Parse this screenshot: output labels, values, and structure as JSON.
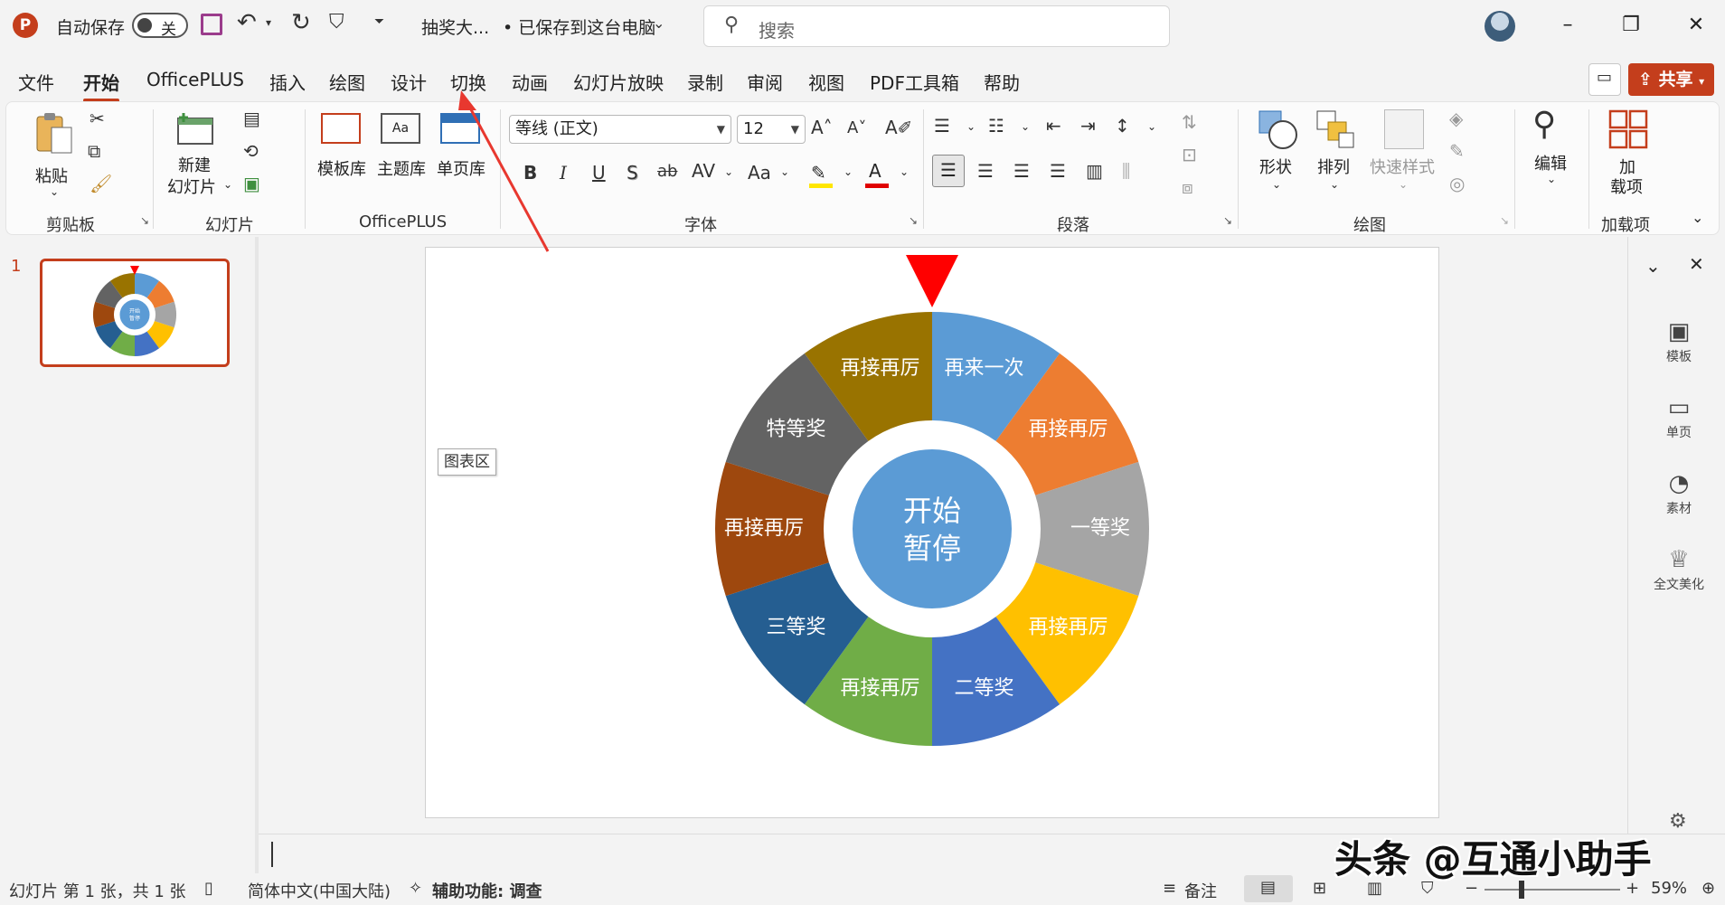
{
  "titlebar": {
    "autosave_label": "自动保存",
    "autosave_state": "关",
    "doc_name": "抽奖大...",
    "save_status": "• 已保存到这台电脑",
    "search_placeholder": "搜索"
  },
  "menu": {
    "tabs": [
      "文件",
      "开始",
      "OfficePLUS",
      "插入",
      "绘图",
      "设计",
      "切换",
      "动画",
      "幻灯片放映",
      "录制",
      "审阅",
      "视图",
      "PDF工具箱",
      "帮助"
    ],
    "active_tab": "开始",
    "share_label": "共享"
  },
  "ribbon": {
    "groups": {
      "clipboard": "剪贴板",
      "slides": "幻灯片",
      "officeplus": "OfficePLUS",
      "font": "字体",
      "paragraph": "段落",
      "drawing": "绘图",
      "addins": "加载项"
    },
    "paste": "粘贴",
    "new_slide_1": "新建",
    "new_slide_2": "幻灯片",
    "template_lib": "模板库",
    "theme_lib": "主题库",
    "page_lib": "单页库",
    "font_name": "等线 (正文)",
    "font_size": "12",
    "shape": "形状",
    "arrange": "排列",
    "quick_style": "快速样式",
    "edit": "编辑",
    "addin_1": "加",
    "addin_2": "载项",
    "font_buttons": [
      "B",
      "I",
      "U",
      "S",
      "ab",
      "AV",
      "Aa"
    ]
  },
  "slide_panel": {
    "slide_number": "1"
  },
  "slide": {
    "chart_tag": "图表区",
    "wheel_segments": [
      {
        "label": "再来一次",
        "color": "#5b9bd5"
      },
      {
        "label": "再接再厉",
        "color": "#ed7d31"
      },
      {
        "label": "一等奖",
        "color": "#a5a5a5"
      },
      {
        "label": "再接再厉",
        "color": "#ffc000"
      },
      {
        "label": "二等奖",
        "color": "#4472c4"
      },
      {
        "label": "再接再厉",
        "color": "#70ad47"
      },
      {
        "label": "三等奖",
        "color": "#255e91"
      },
      {
        "label": "再接再厉",
        "color": "#9e480e"
      },
      {
        "label": "特等奖",
        "color": "#636363"
      },
      {
        "label": "再接再厉",
        "color": "#997300"
      }
    ],
    "center_line1": "开始",
    "center_line2": "暂停",
    "pointer_color": "#ff0000"
  },
  "right_pane": {
    "items": [
      "模板",
      "单页",
      "素材",
      "全文美化"
    ]
  },
  "status": {
    "slide_info": "幻灯片 第 1 张，共 1 张",
    "language": "简体中文(中国大陆)",
    "accessibility": "辅助功能: 调查",
    "notes": "备注",
    "zoom": "59%"
  },
  "watermark": "头条 @互通小助手",
  "colors": {
    "accent": "#c43e1c",
    "annotation_arrow": "#e8382f"
  }
}
